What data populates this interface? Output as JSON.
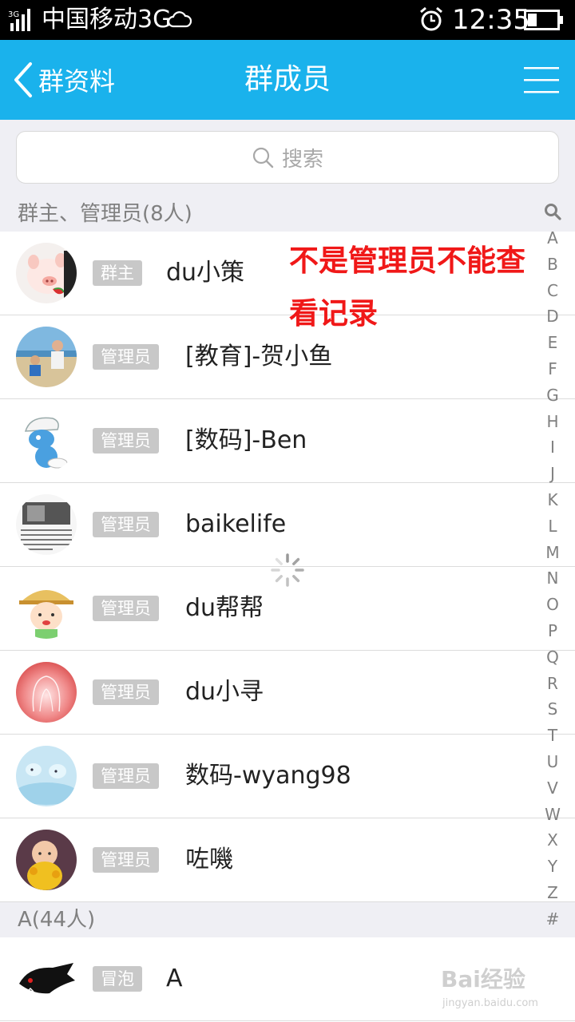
{
  "status_bar": {
    "signal_badge": "3G",
    "carrier": "中国移动3G",
    "time": "12:35"
  },
  "nav": {
    "back_label": "群资料",
    "title": "群成员"
  },
  "search": {
    "placeholder": "搜索"
  },
  "sections": [
    {
      "title": "群主、管理员(8人)"
    },
    {
      "title": "A(44人)"
    }
  ],
  "members": [
    {
      "badge": "群主",
      "name": "du小策"
    },
    {
      "badge": "管理员",
      "name": "[教育]-贺小鱼"
    },
    {
      "badge": "管理员",
      "name": "[数码]-Ben"
    },
    {
      "badge": "管理员",
      "name": "baikelife"
    },
    {
      "badge": "管理员",
      "name": "du帮帮"
    },
    {
      "badge": "管理员",
      "name": "du小寻"
    },
    {
      "badge": "管理员",
      "name": "数码-wyang98"
    },
    {
      "badge": "管理员",
      "name": "咗嘰"
    },
    {
      "badge": "冒泡",
      "name": "A"
    }
  ],
  "annotation": {
    "line1": "不是管理员不能查",
    "line2": "看记录"
  },
  "alphabet_index": [
    "A",
    "B",
    "C",
    "D",
    "E",
    "F",
    "G",
    "H",
    "I",
    "J",
    "K",
    "L",
    "M",
    "N",
    "O",
    "P",
    "Q",
    "R",
    "S",
    "T",
    "U",
    "V",
    "W",
    "X",
    "Y",
    "Z",
    "#"
  ],
  "watermark": {
    "brand": "Bai经验",
    "url": "jingyan.baidu.com"
  },
  "colors": {
    "nav_bg": "#1ab2ec",
    "status_bg": "#000000",
    "section_bg": "#efeff4",
    "badge_bg": "#c8c8c8",
    "annotation": "#f01818"
  }
}
